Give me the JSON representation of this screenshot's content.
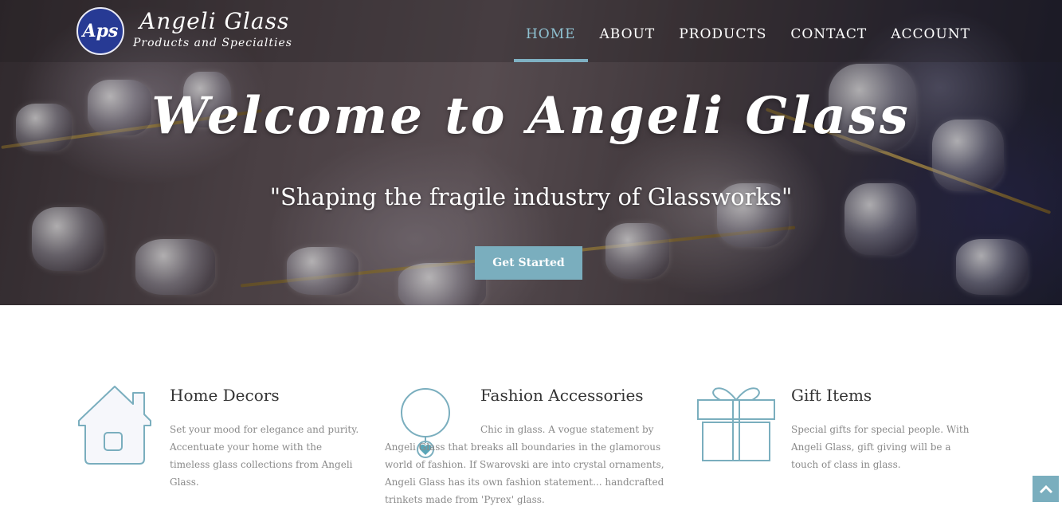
{
  "brand": {
    "badge": "Aps",
    "title": "Angeli Glass",
    "subtitle": "Products and Specialties"
  },
  "nav": {
    "items": [
      {
        "label": "HOME",
        "active": true
      },
      {
        "label": "ABOUT",
        "active": false
      },
      {
        "label": "PRODUCTS",
        "active": false
      },
      {
        "label": "CONTACT",
        "active": false
      },
      {
        "label": "ACCOUNT",
        "active": false
      }
    ]
  },
  "hero": {
    "title": "Welcome to Angeli Glass",
    "tagline": "\"Shaping the fragile industry of Glassworks\"",
    "cta_label": "Get Started"
  },
  "features": [
    {
      "icon": "house-icon",
      "title": "Home Decors",
      "text": "Set your mood for elegance and purity. Accentuate your home with the timeless glass collections from Angeli Glass."
    },
    {
      "icon": "necklace-icon",
      "title": "Fashion Accessories",
      "text": "Chic in glass. A vogue statement by Angeli Glass that breaks all boundaries in the glamorous world of fashion. If Swarovski are into crystal ornaments, Angeli Glass has its own fashion statement... handcrafted trinkets made from 'Pyrex' glass."
    },
    {
      "icon": "gift-icon",
      "title": "Gift Items",
      "text": "Special gifts for special people. With Angeli Glass, gift giving will be a touch of class in glass."
    }
  ],
  "colors": {
    "accent": "#7aaebe",
    "nav_active": "#8fc2d2",
    "badge": "#273a94"
  },
  "back_to_top_icon": "chevron-up-icon"
}
